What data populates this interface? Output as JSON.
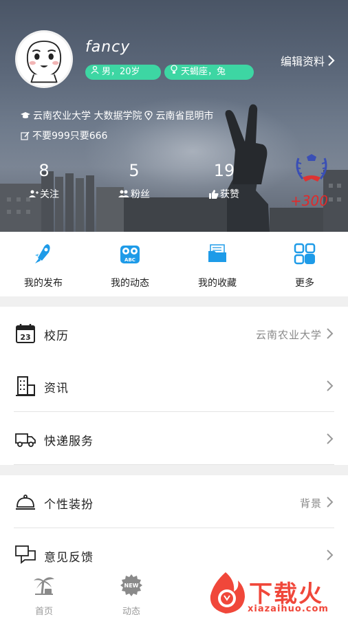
{
  "profile": {
    "username": "fancy",
    "gender_age": "男，20岁",
    "zodiac": "天蝎座，兔",
    "edit_label": "编辑资料",
    "school": "云南农业大学 大数据学院",
    "location": "云南省昆明市",
    "signature": "不要999只要666"
  },
  "stats": [
    {
      "value": "8",
      "label": "关注"
    },
    {
      "value": "5",
      "label": "粉丝"
    },
    {
      "value": "19",
      "label": "获赞"
    }
  ],
  "points": "+300",
  "quick_actions": [
    {
      "label": "我的发布",
      "icon": "rocket-icon"
    },
    {
      "label": "我的动态",
      "icon": "owl-abc-icon"
    },
    {
      "label": "我的收藏",
      "icon": "folder-icon"
    },
    {
      "label": "更多",
      "icon": "apps-icon"
    }
  ],
  "menu": [
    {
      "title": "校历",
      "value": "云南农业大学",
      "icon": "calendar-icon"
    },
    {
      "title": "资讯",
      "value": "",
      "icon": "building-icon"
    },
    {
      "title": "快递服务",
      "value": "",
      "icon": "truck-icon"
    },
    {
      "title": "个性装扮",
      "value": "背景",
      "icon": "cloche-icon"
    },
    {
      "title": "意见反馈",
      "value": "",
      "icon": "chat-icon"
    }
  ],
  "tabs": [
    {
      "label": "首页",
      "icon": "palm-tree-icon"
    },
    {
      "label": "动态",
      "icon": "new-badge-icon",
      "badge": "NEW"
    }
  ],
  "watermark": {
    "text": "下载火",
    "url": "xiazaihuo.com"
  },
  "colors": {
    "badge": "#3dd6a3",
    "points": "#e02a2a",
    "accent_blue": "#1e9be8",
    "watermark": "#f0473a"
  }
}
